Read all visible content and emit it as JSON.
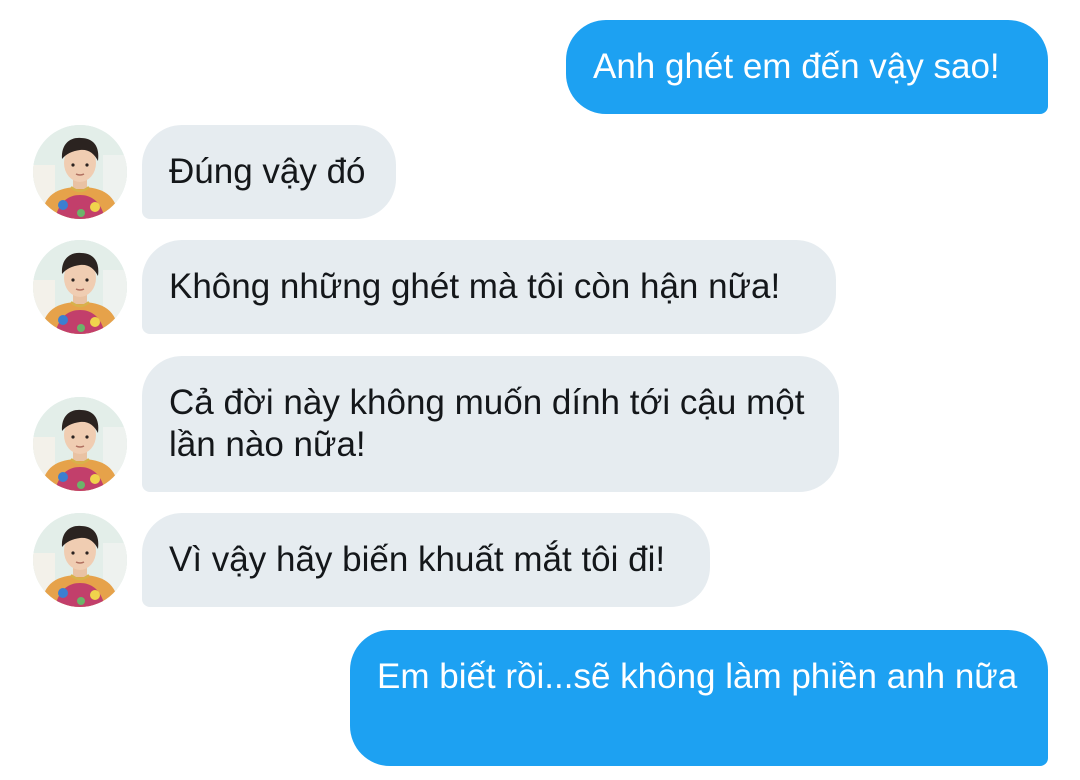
{
  "conversation": {
    "messages": [
      {
        "from": "me",
        "text": "Anh ghét em đến vậy sao!"
      },
      {
        "from": "them",
        "text": "Đúng vậy đó"
      },
      {
        "from": "them",
        "text": "Không những ghét mà tôi còn hận nữa!"
      },
      {
        "from": "them",
        "text": "Cả đời này không muốn dính tới cậu một lần nào nữa!"
      },
      {
        "from": "them",
        "text": "Vì vậy hãy biến khuất mắt tôi đi!"
      },
      {
        "from": "me",
        "text": "Em biết rồi...sẽ không làm phiền anh nữa"
      }
    ]
  },
  "colors": {
    "sent_bubble": "#1da1f2",
    "received_bubble": "#e6ecf0",
    "sent_text": "#ffffff",
    "received_text": "#14171a"
  },
  "icons": {
    "avatar": "contact-avatar-photo"
  }
}
